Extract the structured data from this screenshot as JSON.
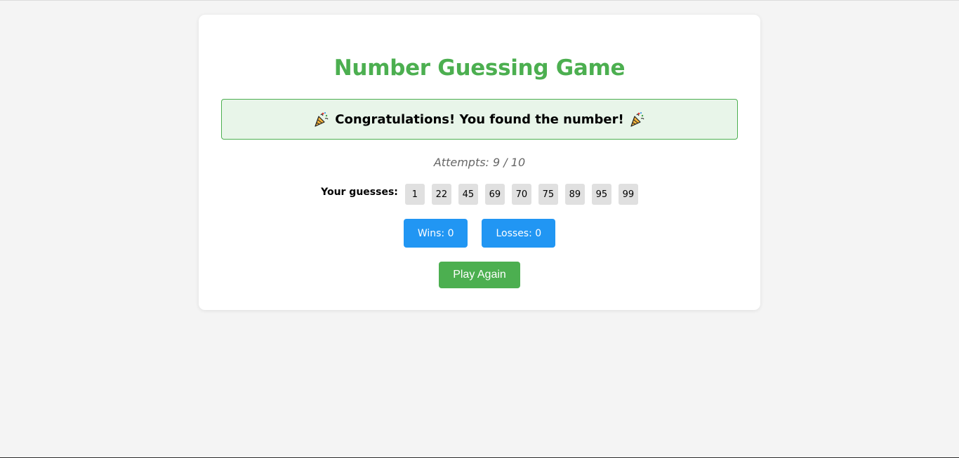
{
  "game": {
    "title": "Number Guessing Game",
    "message": "Congratulations! You found the number!",
    "attempts_text": "Attempts: 9 / 10",
    "guesses_label": "Your guesses:",
    "guesses": [
      "1",
      "22",
      "45",
      "69",
      "70",
      "75",
      "89",
      "95",
      "99"
    ],
    "wins_label": "Wins: 0",
    "losses_label": "Losses: 0",
    "play_again_label": "Play Again"
  },
  "icons": {
    "message_left": "party-popper-icon",
    "message_right": "party-popper-icon"
  },
  "colors": {
    "title": "#4caf50",
    "banner_bg": "#e8f5e9",
    "banner_border": "#4caf50",
    "stat_button": "#2196f3",
    "play_again": "#4caf50",
    "chip_bg": "#e0e0e0",
    "page_bg": "#f4f4f4"
  }
}
